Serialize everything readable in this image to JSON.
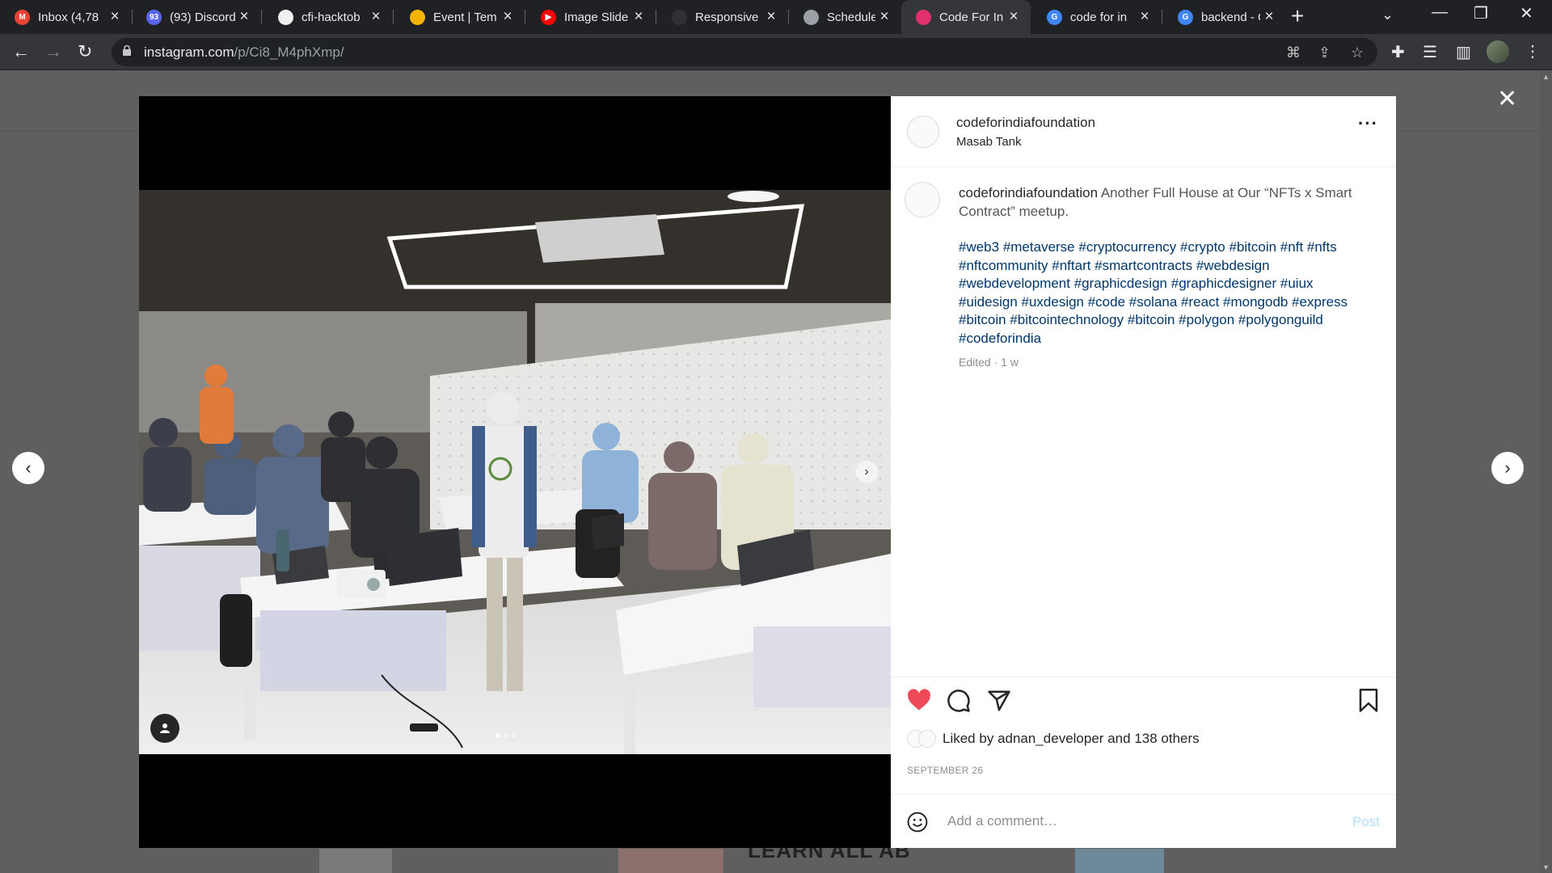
{
  "browser": {
    "tabs": [
      {
        "label": "Inbox (4,78",
        "icon": "gmail-icon",
        "color": "#ea4335",
        "glyph": "M"
      },
      {
        "label": "(93) Discord",
        "icon": "discord-icon",
        "color": "#5865f2",
        "glyph": "93"
      },
      {
        "label": "cfi-hacktob",
        "icon": "github-icon",
        "color": "#f0f0f0",
        "glyph": ""
      },
      {
        "label": "Event | Tem",
        "icon": "event-icon",
        "color": "#f4b400",
        "glyph": ""
      },
      {
        "label": "Image Slide",
        "icon": "youtube-icon",
        "color": "#ff0000",
        "glyph": "▶"
      },
      {
        "label": "Responsive",
        "icon": "site-icon",
        "color": "#303134",
        "glyph": ""
      },
      {
        "label": "Schedule",
        "icon": "globe-icon",
        "color": "#9aa0a6",
        "glyph": ""
      },
      {
        "label": "Code For In",
        "icon": "instagram-icon",
        "color": "#e1306c",
        "glyph": ""
      },
      {
        "label": "code for in",
        "icon": "google-icon",
        "color": "#4285f4",
        "glyph": "G"
      },
      {
        "label": "backend - C",
        "icon": "google-icon",
        "color": "#4285f4",
        "glyph": "G"
      }
    ],
    "active_tab": 7,
    "url_host": "instagram.com",
    "url_path": "/p/Ci8_M4phXmp/"
  },
  "page": {
    "behind_text": "LEARN ALL AB"
  },
  "post": {
    "username": "codeforindiafoundation",
    "location": "Masab Tank",
    "caption_user": "codeforindiafoundation",
    "caption_text": "Another Full House at Our “NFTs x Smart Contract” meetup.",
    "hashtags": "#web3 #metaverse #cryptocurrency #crypto #bitcoin #nft #nfts #nftcommunity #nftart #smartcontracts #webdesign #webdevelopment #graphicdesign #graphicdesigner #uiux #uidesign #uxdesign #code #solana #react #mongodb #express #bitcoin #bitcointechnology #bitcoin #polygon #polygonguild #codeforindia",
    "edited": "Edited · 1 w",
    "liked_prefix": "Liked by",
    "liked_user": "adnan_developer",
    "liked_and": "and",
    "liked_others": "138 others",
    "date": "SEPTEMBER 26",
    "comment_placeholder": "Add a comment…",
    "post_label": "Post",
    "liked": true,
    "slide_count": 3,
    "slide_active": 0
  },
  "colors": {
    "like_red": "#ed4956",
    "hashtag_blue": "#00376b",
    "post_disabled": "#b2dffc"
  }
}
